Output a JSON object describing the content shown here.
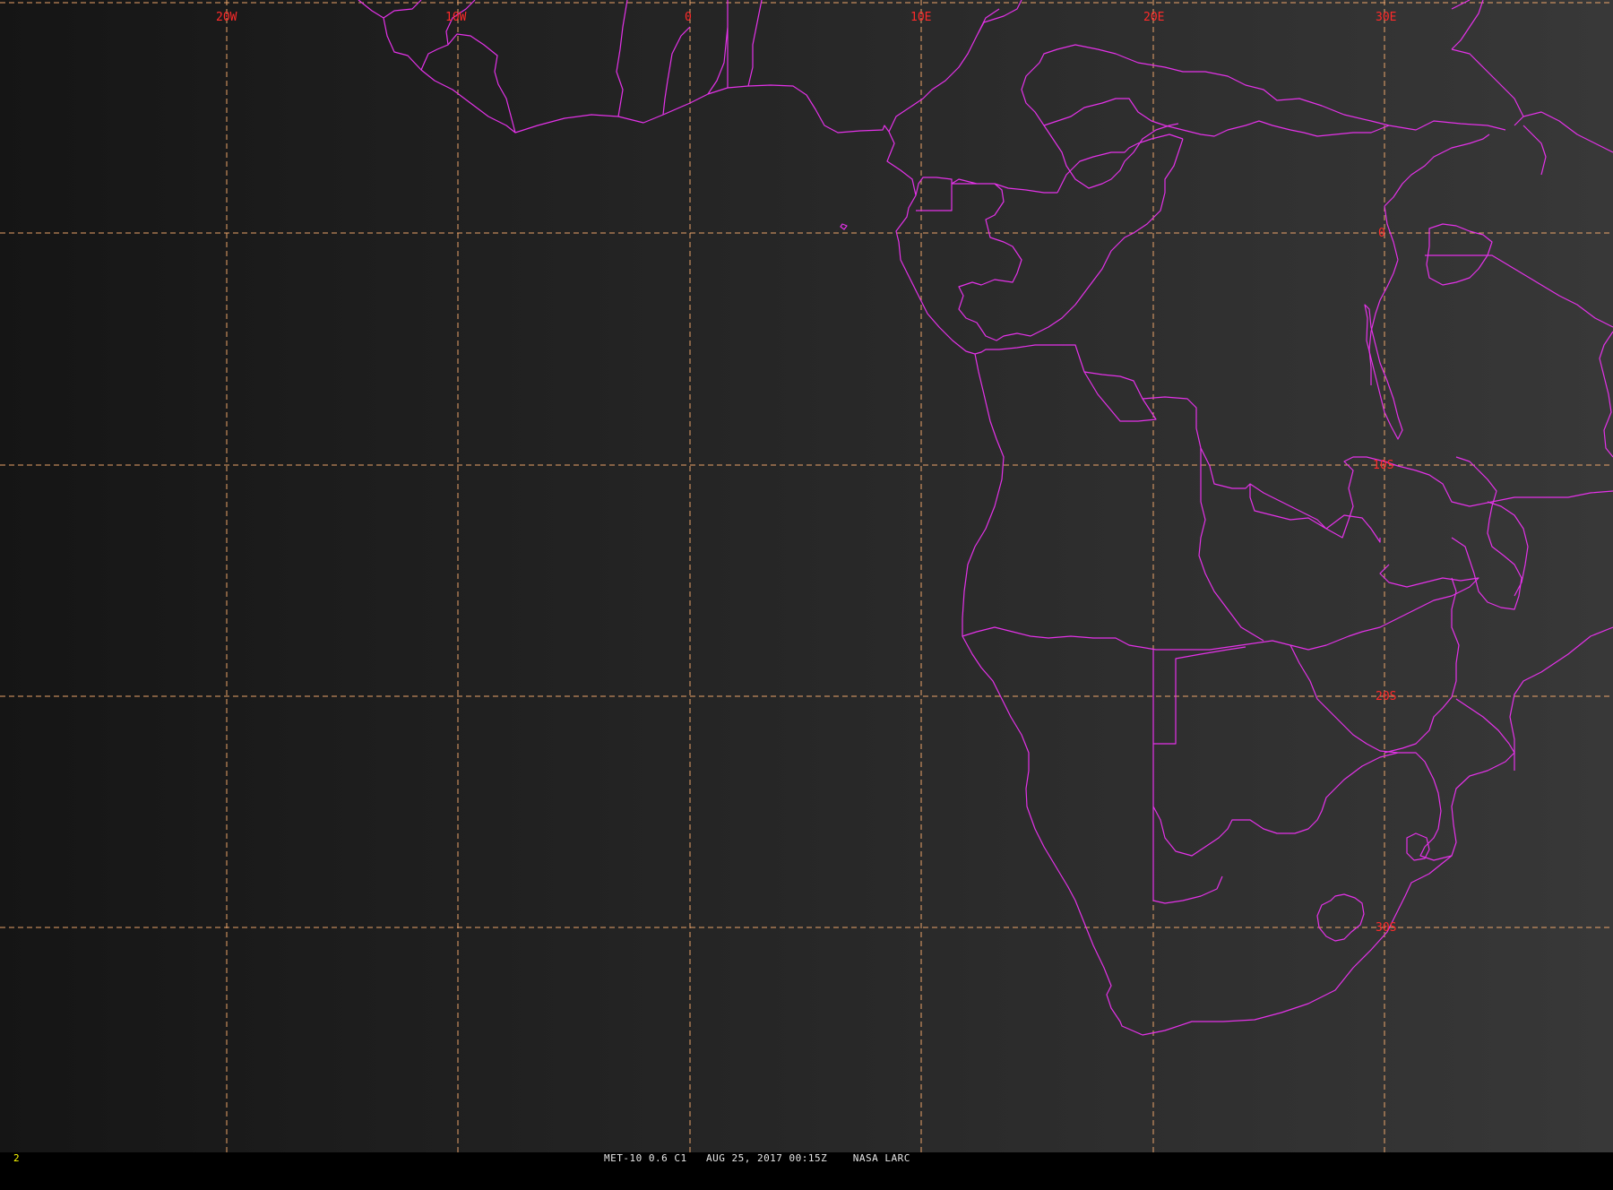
{
  "map": {
    "longitude_labels": [
      "20W",
      "10W",
      "0",
      "10E",
      "20E",
      "30E"
    ],
    "latitude_labels": [
      "0",
      "10S",
      "20S",
      "30S"
    ],
    "colors": {
      "background": "#262626",
      "grid": "#ffb070",
      "boundaries": "#e432e8",
      "labels": "#ff2a2a"
    }
  },
  "status": {
    "frame_number": "2",
    "caption": "MET-10 0.6 C1   AUG 25, 2017 00:15Z    NASA LARC"
  }
}
